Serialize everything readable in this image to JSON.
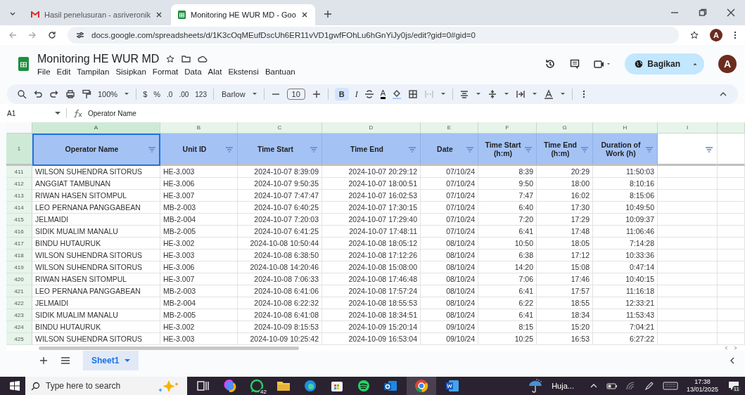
{
  "browser": {
    "tabs": [
      {
        "title": "Hasil penelusuran - asriveronik",
        "selected": false
      },
      {
        "title": "Monitoring HE WUR MD - Goo",
        "selected": true
      }
    ],
    "url": "docs.google.com/spreadsheets/d/1K3cOqMEufDscUh6ER11vVD1gwfFOhLu6hGnYiJy0js/edit?gid=0#gid=0",
    "profile": "A"
  },
  "app": {
    "title": "Monitoring HE WUR MD",
    "menu": [
      "File",
      "Edit",
      "Tampilan",
      "Sisipkan",
      "Format",
      "Data",
      "Alat",
      "Ekstensi",
      "Bantuan"
    ],
    "share": "Bagikan",
    "avatar": "A"
  },
  "toolbar": {
    "zoom": "100%",
    "currency": "$",
    "percent": "%",
    "decimal_decrease": ".0",
    "decimal_increase": ".00",
    "number_format": "123",
    "font": "Barlow",
    "font_size": "10",
    "bold": "B",
    "italic": "I",
    "text_color": "A"
  },
  "formula_bar": {
    "cell": "A1",
    "value": "Operator Name"
  },
  "columns": [
    {
      "letter": "A",
      "selected": true
    },
    {
      "letter": "B",
      "selected": false
    },
    {
      "letter": "C",
      "selected": false
    },
    {
      "letter": "D",
      "selected": false
    },
    {
      "letter": "E",
      "selected": false
    },
    {
      "letter": "F",
      "selected": false
    },
    {
      "letter": "G",
      "selected": false
    },
    {
      "letter": "H",
      "selected": false
    },
    {
      "letter": "I",
      "selected": false
    }
  ],
  "header_row": {
    "number": "1",
    "cells": [
      "Operator Name",
      "Unit ID",
      "Time Start",
      "Time End",
      "Date",
      "Time Start (h:m)",
      "Time End (h:m)",
      "Duration of Work (h)"
    ]
  },
  "rows": [
    {
      "number": "411",
      "cells": [
        "WILSON SUHENDRA SITORUS",
        "HE-3.003",
        "2024-10-07 8:39:09",
        "2024-10-07 20:29:12",
        "07/10/24",
        "8:39",
        "20:29",
        "11:50:03"
      ]
    },
    {
      "number": "412",
      "cells": [
        "ANGGIAT TAMBUNAN",
        "HE-3.006",
        "2024-10-07 9:50:35",
        "2024-10-07 18:00:51",
        "07/10/24",
        "9:50",
        "18:00",
        "8:10:16"
      ]
    },
    {
      "number": "413",
      "cells": [
        "RIWAN HASEN SITOMPUL",
        "HE-3.007",
        "2024-10-07 7:47:47",
        "2024-10-07 16:02:53",
        "07/10/24",
        "7:47",
        "16:02",
        "8:15:06"
      ]
    },
    {
      "number": "414",
      "cells": [
        "LEO PERNANA PANGGABEAN",
        "MB-2-003",
        "2024-10-07 6:40:25",
        "2024-10-07 17:30:15",
        "07/10/24",
        "6:40",
        "17:30",
        "10:49:50"
      ]
    },
    {
      "number": "415",
      "cells": [
        "JELMAIDI",
        "MB-2-004",
        "2024-10-07 7:20:03",
        "2024-10-07 17:29:40",
        "07/10/24",
        "7:20",
        "17:29",
        "10:09:37"
      ]
    },
    {
      "number": "416",
      "cells": [
        "SIDIK MUALIM MANALU",
        "MB-2-005",
        "2024-10-07 6:41:25",
        "2024-10-07 17:48:11",
        "07/10/24",
        "6:41",
        "17:48",
        "11:06:46"
      ]
    },
    {
      "number": "417",
      "cells": [
        "BINDU HUTAURUK",
        "HE-3.002",
        "2024-10-08 10:50:44",
        "2024-10-08 18:05:12",
        "08/10/24",
        "10:50",
        "18:05",
        "7:14:28"
      ]
    },
    {
      "number": "418",
      "cells": [
        "WILSON SUHENDRA SITORUS",
        "HE-3.003",
        "2024-10-08 6:38:50",
        "2024-10-08 17:12:26",
        "08/10/24",
        "6:38",
        "17:12",
        "10:33:36"
      ]
    },
    {
      "number": "419",
      "cells": [
        "WILSON SUHENDRA SITORUS",
        "HE-3.006",
        "2024-10-08 14:20:46",
        "2024-10-08 15:08:00",
        "08/10/24",
        "14:20",
        "15:08",
        "0:47:14"
      ]
    },
    {
      "number": "420",
      "cells": [
        "RIWAN HASEN SITOMPUL",
        "HE-3.007",
        "2024-10-08 7:06:33",
        "2024-10-08 17:46:48",
        "08/10/24",
        "7:06",
        "17:46",
        "10:40:15"
      ]
    },
    {
      "number": "421",
      "cells": [
        "LEO PERNANA PANGGABEAN",
        "MB-2-003",
        "2024-10-08 6:41:06",
        "2024-10-08 17:57:24",
        "08/10/24",
        "6:41",
        "17:57",
        "11:16:18"
      ]
    },
    {
      "number": "422",
      "cells": [
        "JELMAIDI",
        "MB-2-004",
        "2024-10-08 6:22:32",
        "2024-10-08 18:55:53",
        "08/10/24",
        "6:22",
        "18:55",
        "12:33:21"
      ]
    },
    {
      "number": "423",
      "cells": [
        "SIDIK MUALIM MANALU",
        "MB-2-005",
        "2024-10-08 6:41:08",
        "2024-10-08 18:34:51",
        "08/10/24",
        "6:41",
        "18:34",
        "11:53:43"
      ]
    },
    {
      "number": "424",
      "cells": [
        "BINDU HUTAURUK",
        "HE-3.002",
        "2024-10-09 8:15:53",
        "2024-10-09 15:20:14",
        "09/10/24",
        "8:15",
        "15:20",
        "7:04:21"
      ]
    },
    {
      "number": "425",
      "cells": [
        "WILSON SUHENDRA SITORUS",
        "HE-3.003",
        "2024-10-09 10:25:42",
        "2024-10-09 16:53:04",
        "09/10/24",
        "10:25",
        "16:53",
        "6:27:22"
      ]
    }
  ],
  "sheet_tabs": [
    {
      "name": "Sheet1",
      "selected": true
    }
  ],
  "taskbar": {
    "search_placeholder": "Type here to search",
    "whatsapp_badge": "42",
    "weather": "Huja...",
    "time": "17:38",
    "date": "13/01/2025",
    "notifications": "11"
  }
}
